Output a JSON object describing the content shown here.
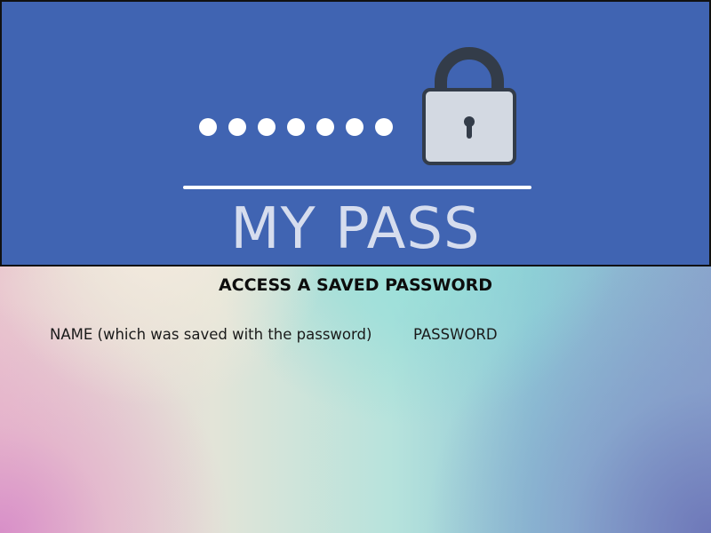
{
  "header": {
    "title": "MY PASS",
    "masked_password": "•••••••",
    "lock_icon": "padlock-icon",
    "colors": {
      "banner_background": "#4064b2",
      "title_text": "#d6ddee",
      "accent_white": "#ffffff"
    }
  },
  "main": {
    "heading": "ACCESS A SAVED PASSWORD",
    "columns": {
      "name_label": "NAME (which was saved with the password)",
      "password_label": "PASSWORD"
    }
  }
}
